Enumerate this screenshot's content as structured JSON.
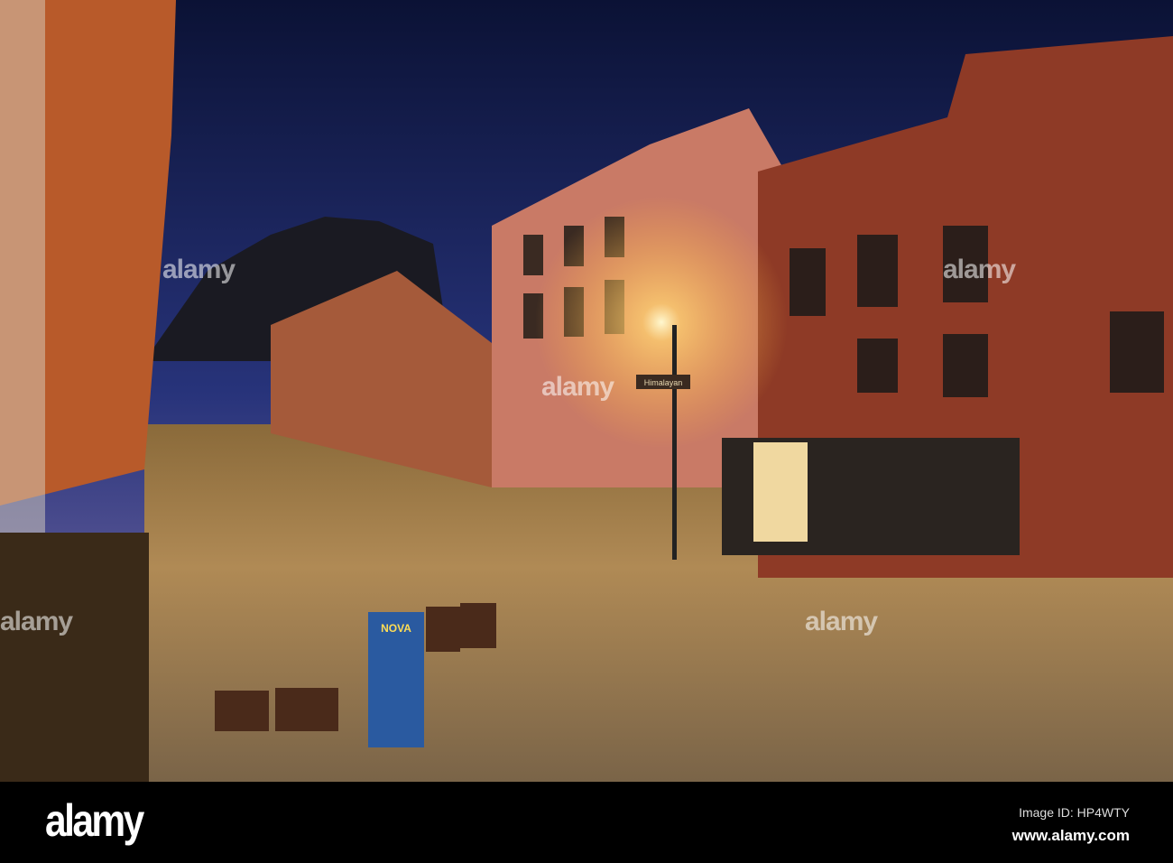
{
  "photo": {
    "signs": {
      "ice_cream_brand": "NOVA",
      "shop_sign": "Himalayan"
    },
    "watermark": "alamy"
  },
  "footer": {
    "logo": "alamy",
    "image_id": "Image ID: HP4WTY",
    "url": "www.alamy.com"
  }
}
